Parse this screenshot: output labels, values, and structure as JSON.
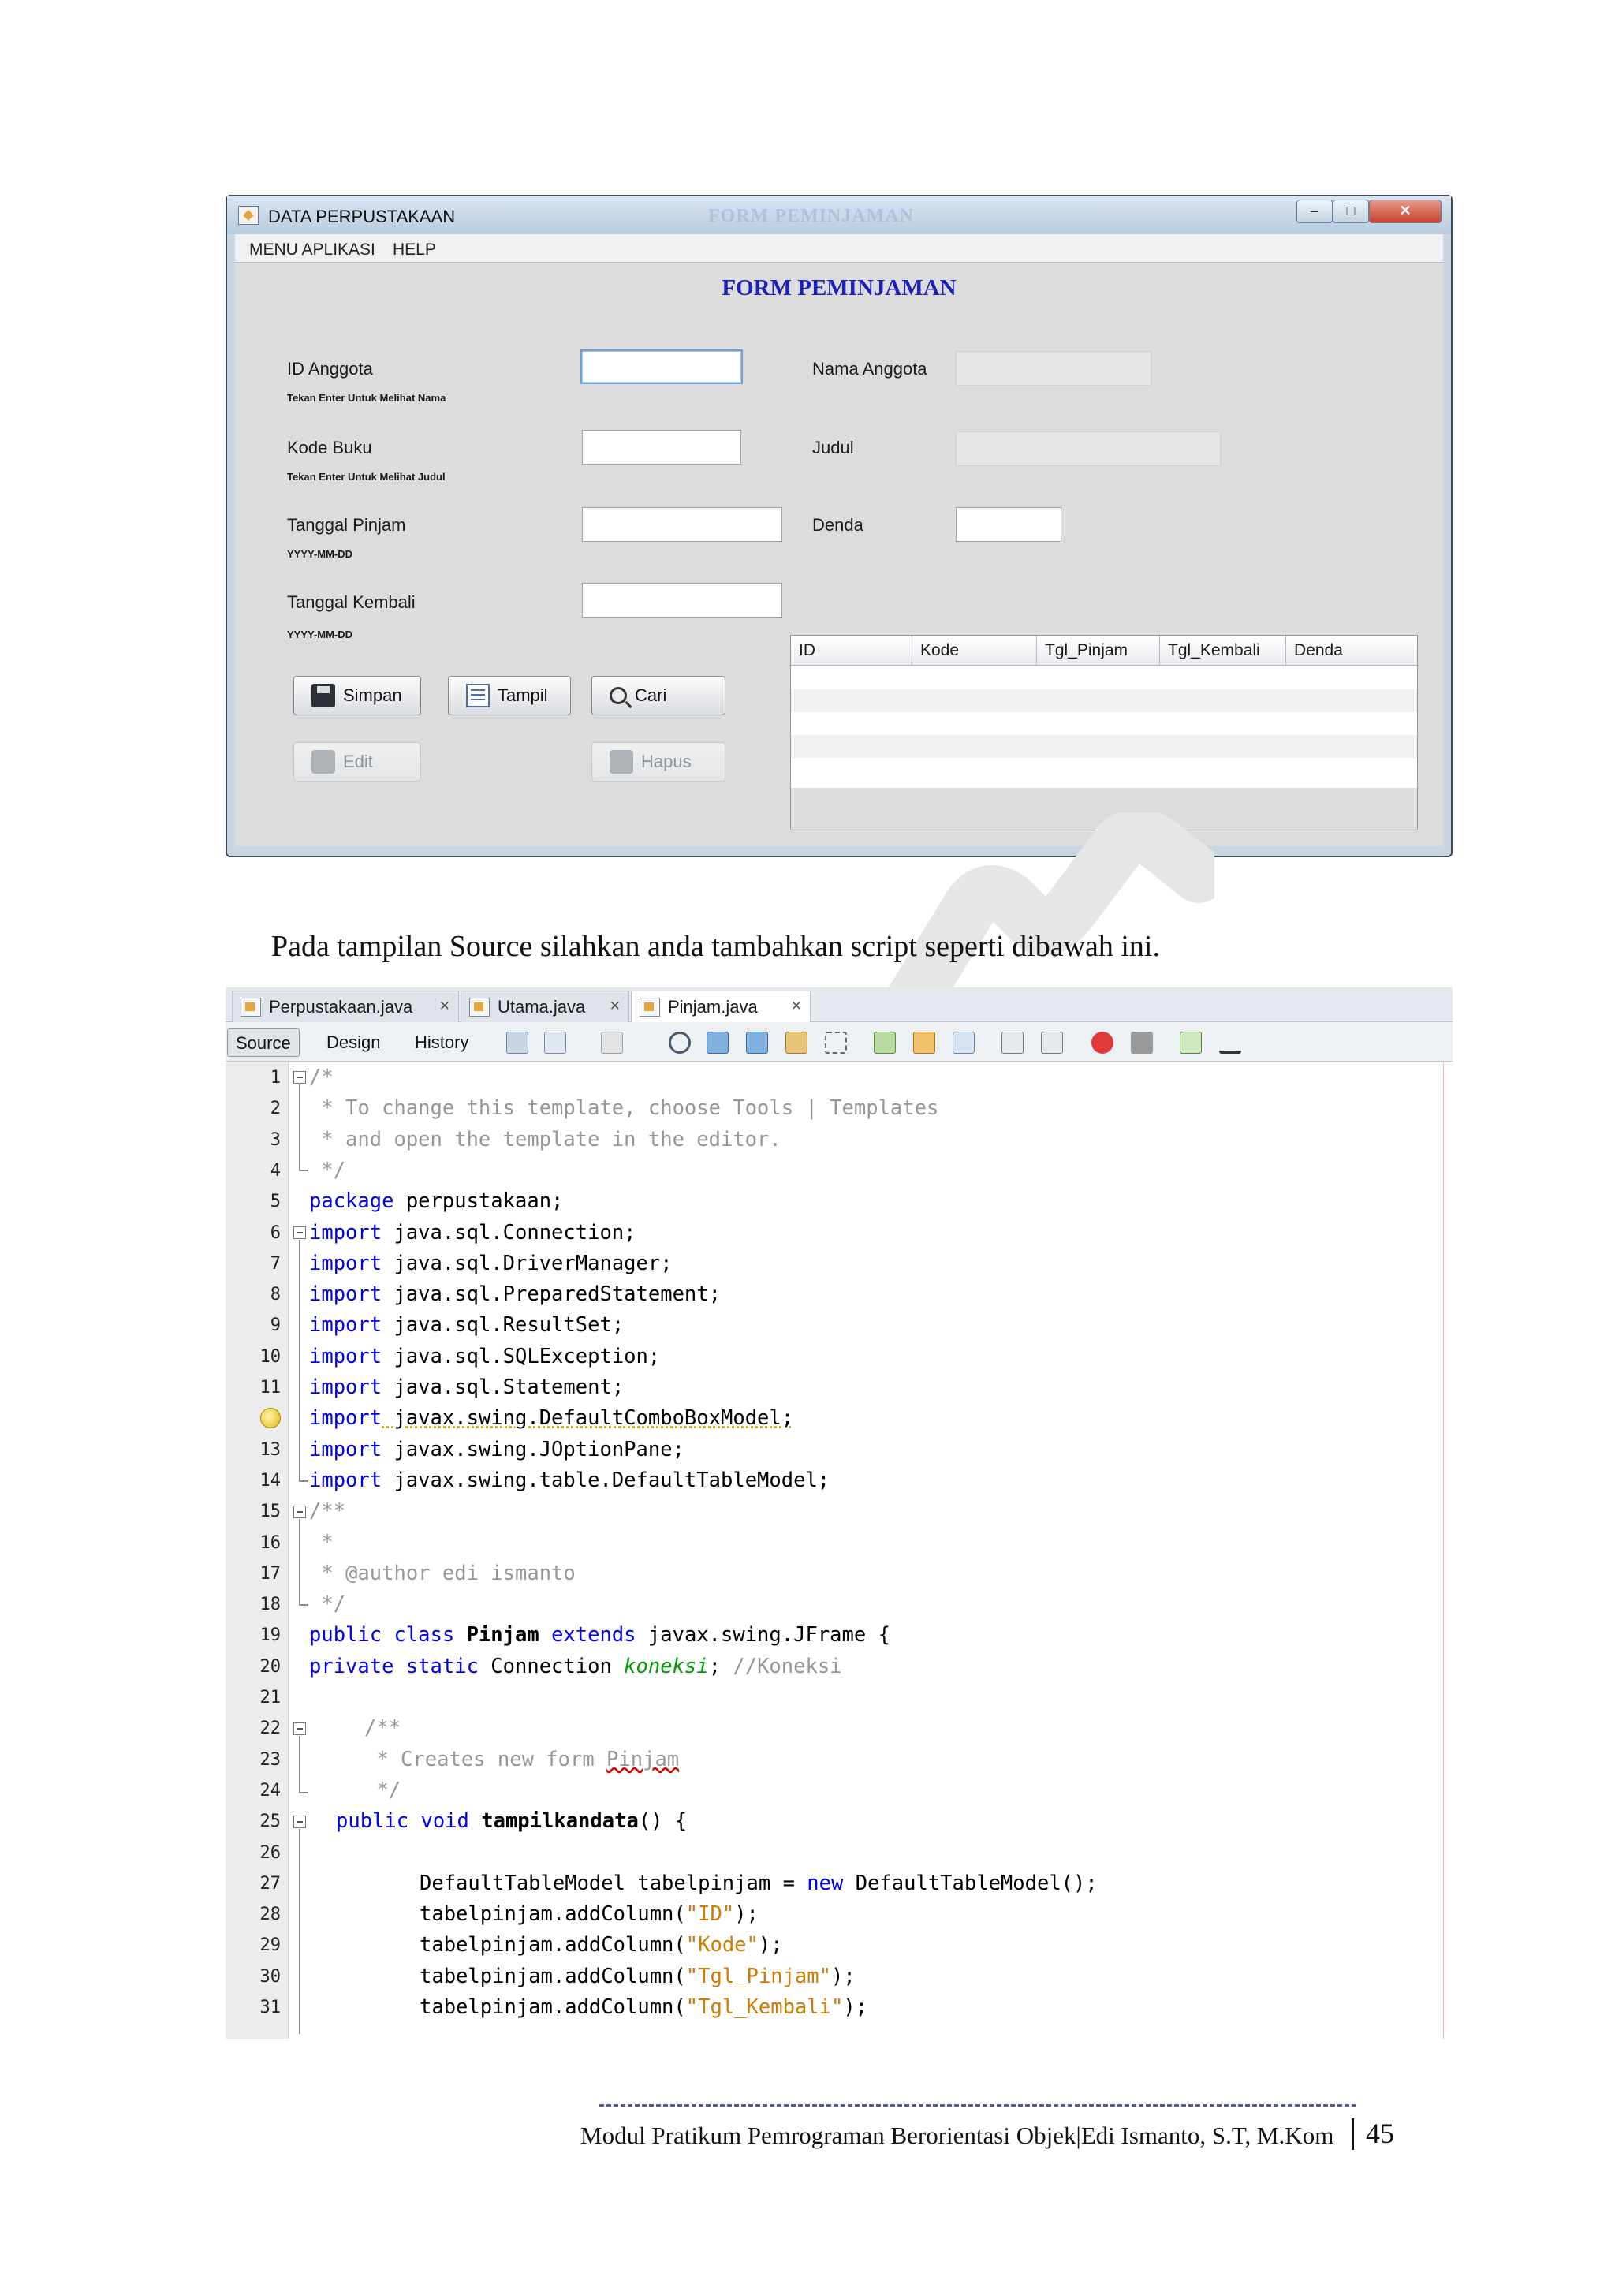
{
  "window": {
    "title": "DATA PERPUSTAKAAN",
    "title_ghost": "FORM PEMINJAMAN",
    "menu": [
      "MENU APLIKASI",
      "HELP"
    ],
    "form_title": "FORM PEMINJAMAN",
    "labels": {
      "id_anggota": "ID Anggota",
      "id_hint": "Tekan Enter Untuk Melihat Nama",
      "kode_buku": "Kode Buku",
      "kode_hint": "Tekan Enter Untuk Melihat Judul",
      "tgl_pinjam": "Tanggal Pinjam",
      "tgl_pinjam_hint": "YYYY-MM-DD",
      "tgl_kembali": "Tanggal Kembali",
      "tgl_kembali_hint": "YYYY-MM-DD",
      "nama_anggota": "Nama Anggota",
      "judul": "Judul",
      "denda": "Denda"
    },
    "buttons": {
      "simpan": "Simpan",
      "tampil": "Tampil",
      "cari": "Cari",
      "edit": "Edit",
      "hapus": "Hapus"
    },
    "table_columns": [
      "ID",
      "Kode",
      "Tgl_Pinjam",
      "Tgl_Kembali",
      "Denda"
    ]
  },
  "paragraph": "Pada tampilan Source silahkan anda tambahkan script seperti dibawah ini.",
  "ide": {
    "file_tabs": [
      "Perpustakaan.java",
      "Utama.java",
      "Pinjam.java"
    ],
    "view_tabs": [
      "Source",
      "Design",
      "History"
    ],
    "line_numbers": [
      "1",
      "2",
      "3",
      "4",
      "5",
      "6",
      "7",
      "8",
      "9",
      "10",
      "11",
      "",
      "13",
      "14",
      "15",
      "16",
      "17",
      "18",
      "19",
      "20",
      "21",
      "22",
      "23",
      "24",
      "25",
      "26",
      "27",
      "28",
      "29",
      "30",
      "31"
    ],
    "code": {
      "l1": "/*",
      "l2": " * To change this template, choose Tools | Templates",
      "l3": " * and open the template in the editor.",
      "l4": " */",
      "l5_kw": "package",
      "l5": " perpustakaan;",
      "import_kw": "import",
      "l6": " java.sql.Connection;",
      "l7": " java.sql.DriverManager;",
      "l8": " java.sql.PreparedStatement;",
      "l9": " java.sql.ResultSet;",
      "l10": " java.sql.SQLException;",
      "l11": " java.sql.Statement;",
      "l12": " javax.swing.DefaultComboBoxModel;",
      "l13": " javax.swing.JOptionPane;",
      "l14": " javax.swing.table.DefaultTableModel;",
      "l15": "/**",
      "l16": " *",
      "l17": " * @author edi ismanto",
      "l18": " */",
      "l19_kw": "public class",
      "l19_name": " Pinjam ",
      "l19_kw2": "extends",
      "l19_rest": " javax.swing.JFrame {",
      "l20_kw": "private static",
      "l20_type": " Connection ",
      "l20_field": "koneksi",
      "l20_semi": "; ",
      "l20_cm": "//Koneksi",
      "l22": "/**",
      "l23_a": " * Creates new form ",
      "l23_b": "Pinjam",
      "l24": " */",
      "l25_kw": "public void",
      "l25_name": " tampilkandata",
      "l25_rest": "() {",
      "l27_a": "DefaultTableModel tabelpinjam = ",
      "l27_kw": "new",
      "l27_b": " DefaultTableModel();",
      "add_prefix": "tabelpinjam.addColumn(",
      "add_suffix": ");",
      "s28": "\"ID\"",
      "s29": "\"Kode\"",
      "s30": "\"Tgl_Pinjam\"",
      "s31": "\"Tgl_Kembali\""
    }
  },
  "footer": {
    "text": "Modul Pratikum Pemrograman Berorientasi Objek|Edi Ismanto, S.T, M.Kom",
    "page": "45"
  },
  "colors": {
    "keyword": "#0000e6",
    "comment": "#969696",
    "string": "#ce7b00",
    "field": "#009900",
    "form_title": "#1c22b8"
  }
}
